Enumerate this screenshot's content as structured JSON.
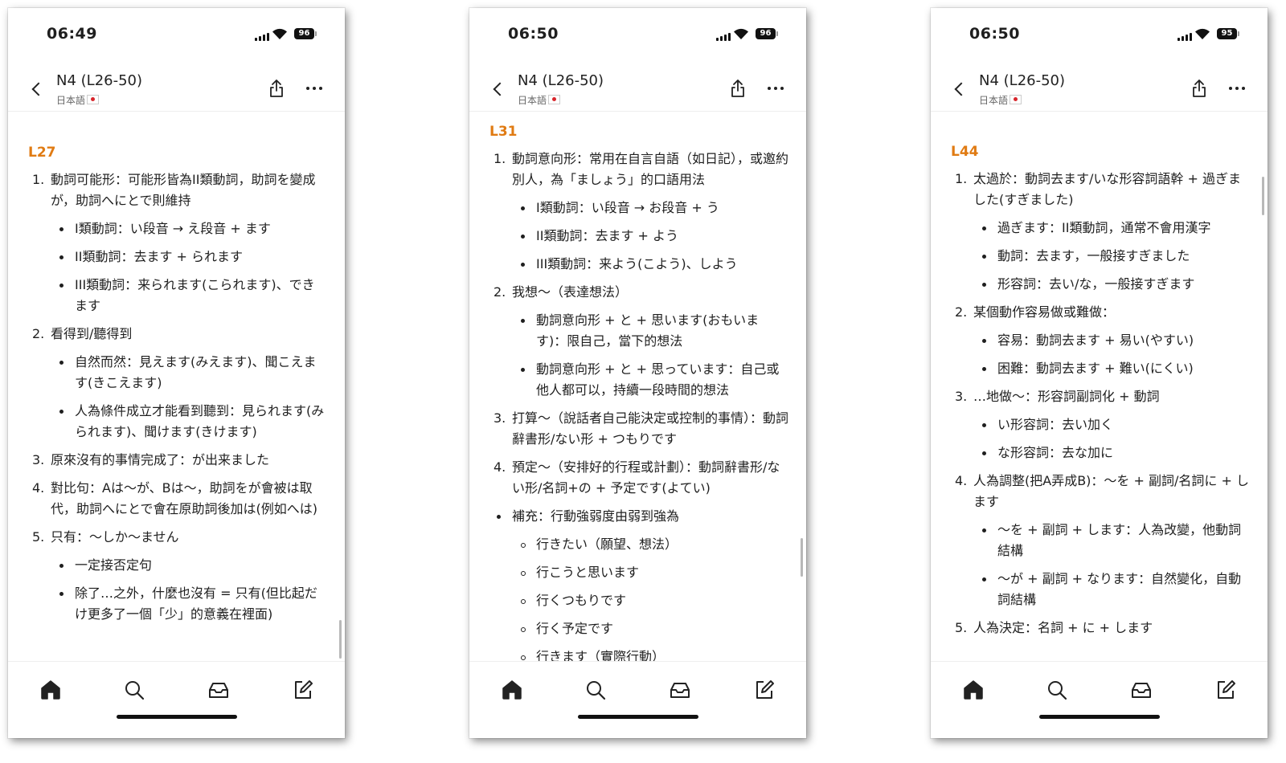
{
  "screens": [
    {
      "time": "06:49",
      "battery": "96",
      "title": "N4 (L26-50)",
      "subtitle": "日本語",
      "heading": "L27",
      "items": [
        {
          "marker": "1.",
          "text": "動詞可能形：可能形皆為II類動詞，助詞を變成が，助詞へにとで則維持",
          "children": [
            "I類動詞：い段音 → え段音 + ます",
            "II類動詞：去ます + られます",
            "III類動詞：来られます(こられます)、できます"
          ]
        },
        {
          "marker": "2.",
          "text": "看得到/聽得到",
          "children": [
            "自然而然：見えます(みえます)、聞こえます(きこえます)",
            "人為條件成立才能看到聽到：見られます(みられます)、聞けます(きけます)"
          ]
        },
        {
          "marker": "3.",
          "text": "原來沒有的事情完成了：が出来ました"
        },
        {
          "marker": "4.",
          "text": "對比句：Aは～が、Bは～，助詞をが會被は取代，助詞へにとで會在原助詞後加は(例如へは)"
        },
        {
          "marker": "5.",
          "text": "只有：～しか～ません",
          "children": [
            "一定接否定句",
            "除了…之外，什麼也沒有 = 只有(但比起だけ更多了一個「少」的意義在裡面)"
          ]
        }
      ]
    },
    {
      "time": "06:50",
      "battery": "96",
      "title": "N4 (L26-50)",
      "subtitle": "日本語",
      "heading": "L31",
      "items": [
        {
          "marker": "1.",
          "text": "動詞意向形：常用在自言自語（如日記），或邀約別人，為「ましょう」的口語用法",
          "children": [
            "I類動詞：い段音 → お段音 + う",
            "II類動詞：去ます + よう",
            "III類動詞：来よう(こよう)、しよう"
          ]
        },
        {
          "marker": "2.",
          "text": "我想～（表達想法）",
          "children": [
            "動詞意向形 + と + 思います(おもいます)：限自己，當下的想法",
            "動詞意向形 + と + 思っています：自己或他人都可以，持續一段時間的想法"
          ]
        },
        {
          "marker": "3.",
          "text": "打算～（說話者自己能決定或控制的事情）：動詞辭書形/ない形 + つもりです"
        },
        {
          "marker": "4.",
          "text": "預定～（安排好的行程或計劃）：動詞辭書形/ない形/名詞+の + 予定です(よてい)"
        },
        {
          "marker": "•",
          "bullet": true,
          "text": "補充：行動強弱度由弱到強為",
          "circle": true,
          "children": [
            "行きたい（願望、想法）",
            "行こうと思います",
            "行くつもりです",
            "行く予定です",
            "行きます（實際行動）"
          ]
        }
      ]
    },
    {
      "time": "06:50",
      "battery": "95",
      "title": "N4 (L26-50)",
      "subtitle": "日本語",
      "heading": "L44",
      "items": [
        {
          "marker": "1.",
          "text": "太過於：動詞去ます/いな形容詞語幹 + 過ぎました(すぎました)",
          "children": [
            "過ぎます：II類動詞，通常不會用漢字",
            "動詞：去ます，一般接すぎました",
            "形容詞：去い/な，一般接すぎます"
          ]
        },
        {
          "marker": "2.",
          "text": "某個動作容易做或難做：",
          "children": [
            "容易：動詞去ます + 易い(やすい)",
            "困難：動詞去ます + 難い(にくい)"
          ]
        },
        {
          "marker": "3.",
          "text": "…地做～：形容詞副詞化 + 動詞",
          "children": [
            "い形容詞：去い加く",
            "な形容詞：去な加に"
          ]
        },
        {
          "marker": "4.",
          "text": "人為調整(把A弄成B)：～を + 副詞/名詞に + します",
          "children": [
            "～を + 副詞 + します：人為改變，他動詞結構",
            "～が + 副詞 + なります：自然變化，自動詞結構"
          ]
        },
        {
          "marker": "5.",
          "text": "人為決定：名詞 + に + します"
        }
      ]
    }
  ],
  "tabs": [
    {
      "icon": "home-icon",
      "active": true
    },
    {
      "icon": "search-icon"
    },
    {
      "icon": "inbox-icon"
    },
    {
      "icon": "compose-icon"
    }
  ],
  "colors": {
    "heading": "#e07b13",
    "text": "#1f1f1f",
    "icon": "#222222"
  }
}
